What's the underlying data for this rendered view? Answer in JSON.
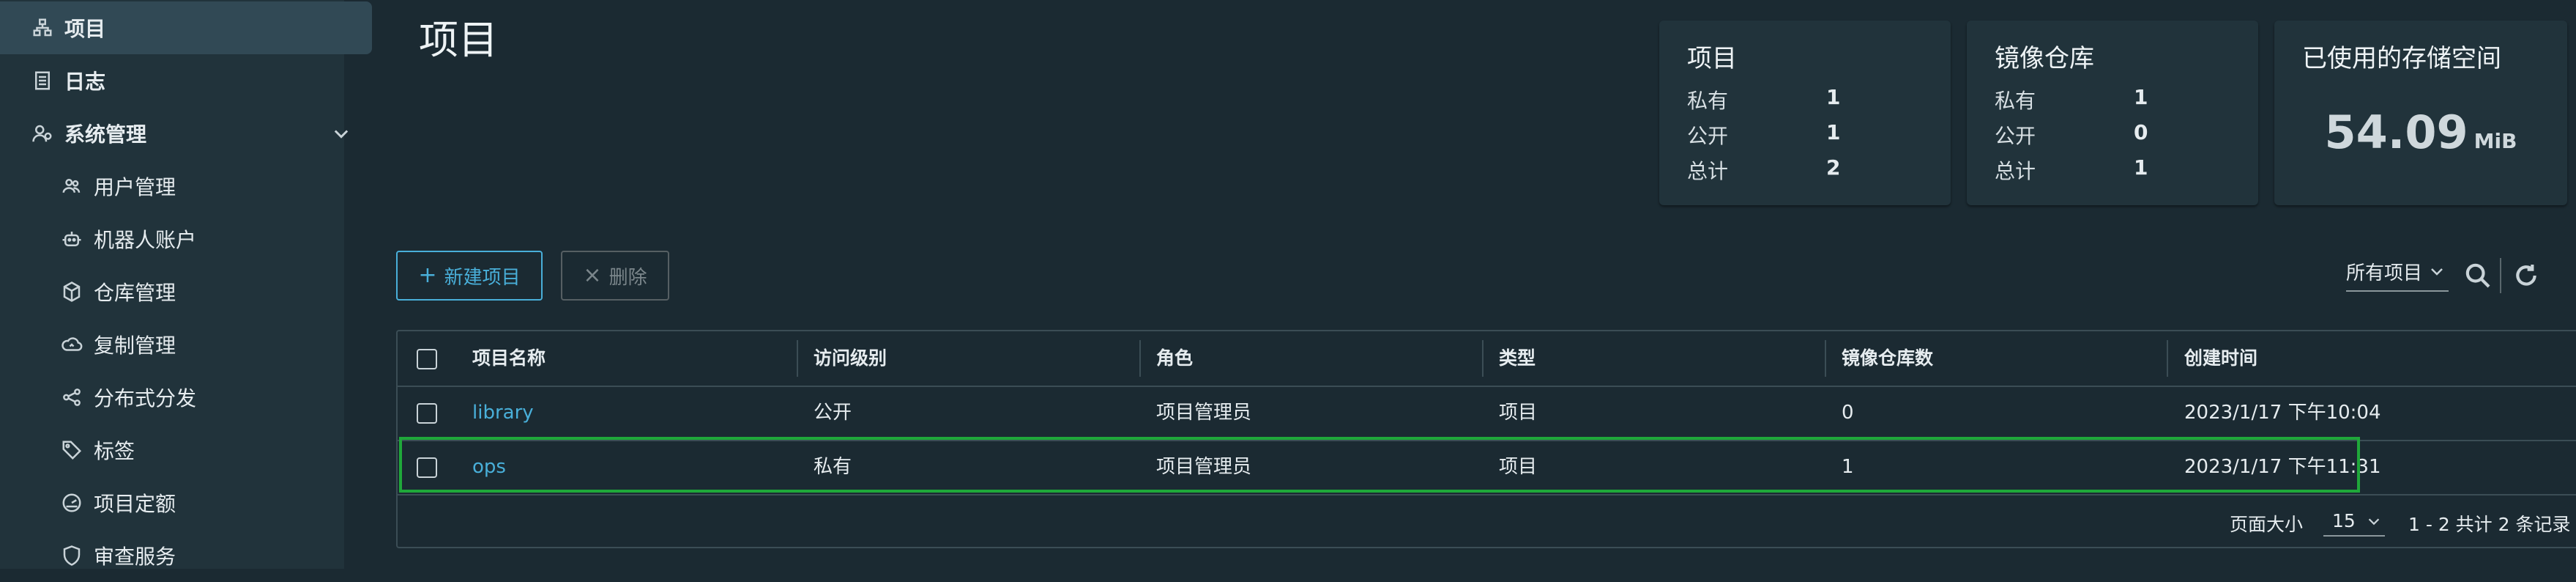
{
  "sidebar": {
    "items": [
      {
        "label": "项目",
        "icon": "project-icon",
        "active": true
      },
      {
        "label": "日志",
        "icon": "log-icon"
      },
      {
        "label": "系统管理",
        "icon": "admin-icon"
      },
      {
        "label": "用户管理",
        "icon": "users-icon"
      },
      {
        "label": "机器人账户",
        "icon": "robot-icon"
      },
      {
        "label": "仓库管理",
        "icon": "registry-icon"
      },
      {
        "label": "复制管理",
        "icon": "replication-icon"
      },
      {
        "label": "分布式分发",
        "icon": "distribution-icon"
      },
      {
        "label": "标签",
        "icon": "tag-icon"
      },
      {
        "label": "项目定额",
        "icon": "quota-icon"
      },
      {
        "label": "审查服务",
        "icon": "shield-icon"
      }
    ]
  },
  "page": {
    "title": "项目"
  },
  "cards": {
    "projects": {
      "title": "项目",
      "private_label": "私有",
      "private": "1",
      "public_label": "公开",
      "public": "1",
      "total_label": "总计",
      "total": "2"
    },
    "repos": {
      "title": "镜像仓库",
      "private_label": "私有",
      "private": "1",
      "public_label": "公开",
      "public": "0",
      "total_label": "总计",
      "total": "1"
    },
    "storage": {
      "title": "已使用的存储空间",
      "value": "54.09",
      "unit": "MiB"
    }
  },
  "toolbar": {
    "new_label": "新建项目",
    "delete_label": "删除",
    "filter_value": "所有项目"
  },
  "table": {
    "headers": [
      "项目名称",
      "访问级别",
      "角色",
      "类型",
      "镜像仓库数",
      "创建时间"
    ],
    "rows": [
      {
        "name": "library",
        "access": "公开",
        "role": "项目管理员",
        "type": "项目",
        "repos": "0",
        "created": "2023/1/17 下午10:04"
      },
      {
        "name": "ops",
        "access": "私有",
        "role": "项目管理员",
        "type": "项目",
        "repos": "1",
        "created": "2023/1/17 下午11:31"
      }
    ],
    "footer": {
      "page_size_label": "页面大小",
      "page_size": "15",
      "count_text": "1 - 2 共计 2 条记录"
    }
  },
  "colors": {
    "accent": "#49afd9",
    "highlight": "#1fa83a",
    "background": "#1b2a32",
    "card": "#21333b"
  }
}
